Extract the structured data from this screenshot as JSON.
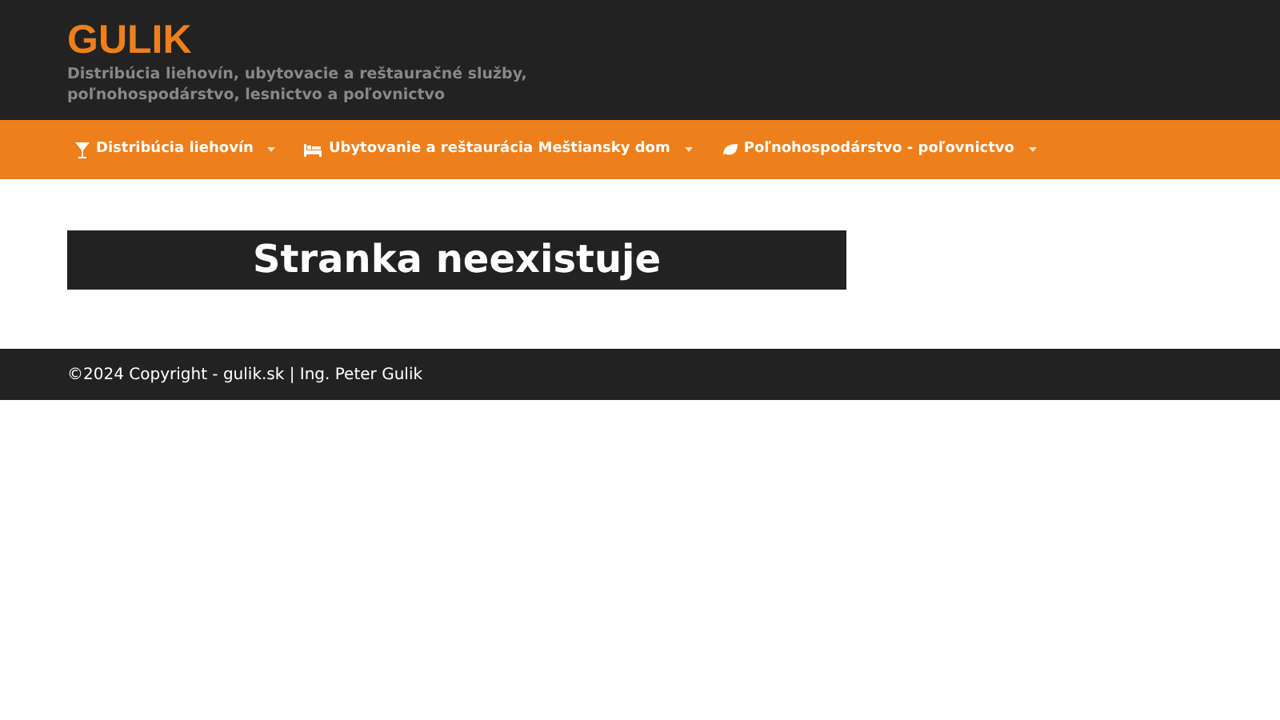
{
  "site": {
    "title": "GULIK",
    "tagline": "Distribúcia liehovín, ubytovacie a reštauračné služby, poľnohospodárstvo, lesnictvo a poľovnictvo"
  },
  "nav": [
    {
      "label": "Distribúcia liehovín",
      "kind": "glass"
    },
    {
      "label": "Ubytovanie a reštaurácia Meštiansky dom",
      "kind": "bed"
    },
    {
      "label": "Poľnohospodárstvo - poľovnictvo",
      "kind": "leaf"
    }
  ],
  "page_title": "Stranka neexistuje",
  "footer": "©2024 Copyright - gulik.sk | Ing. Peter Gulik"
}
